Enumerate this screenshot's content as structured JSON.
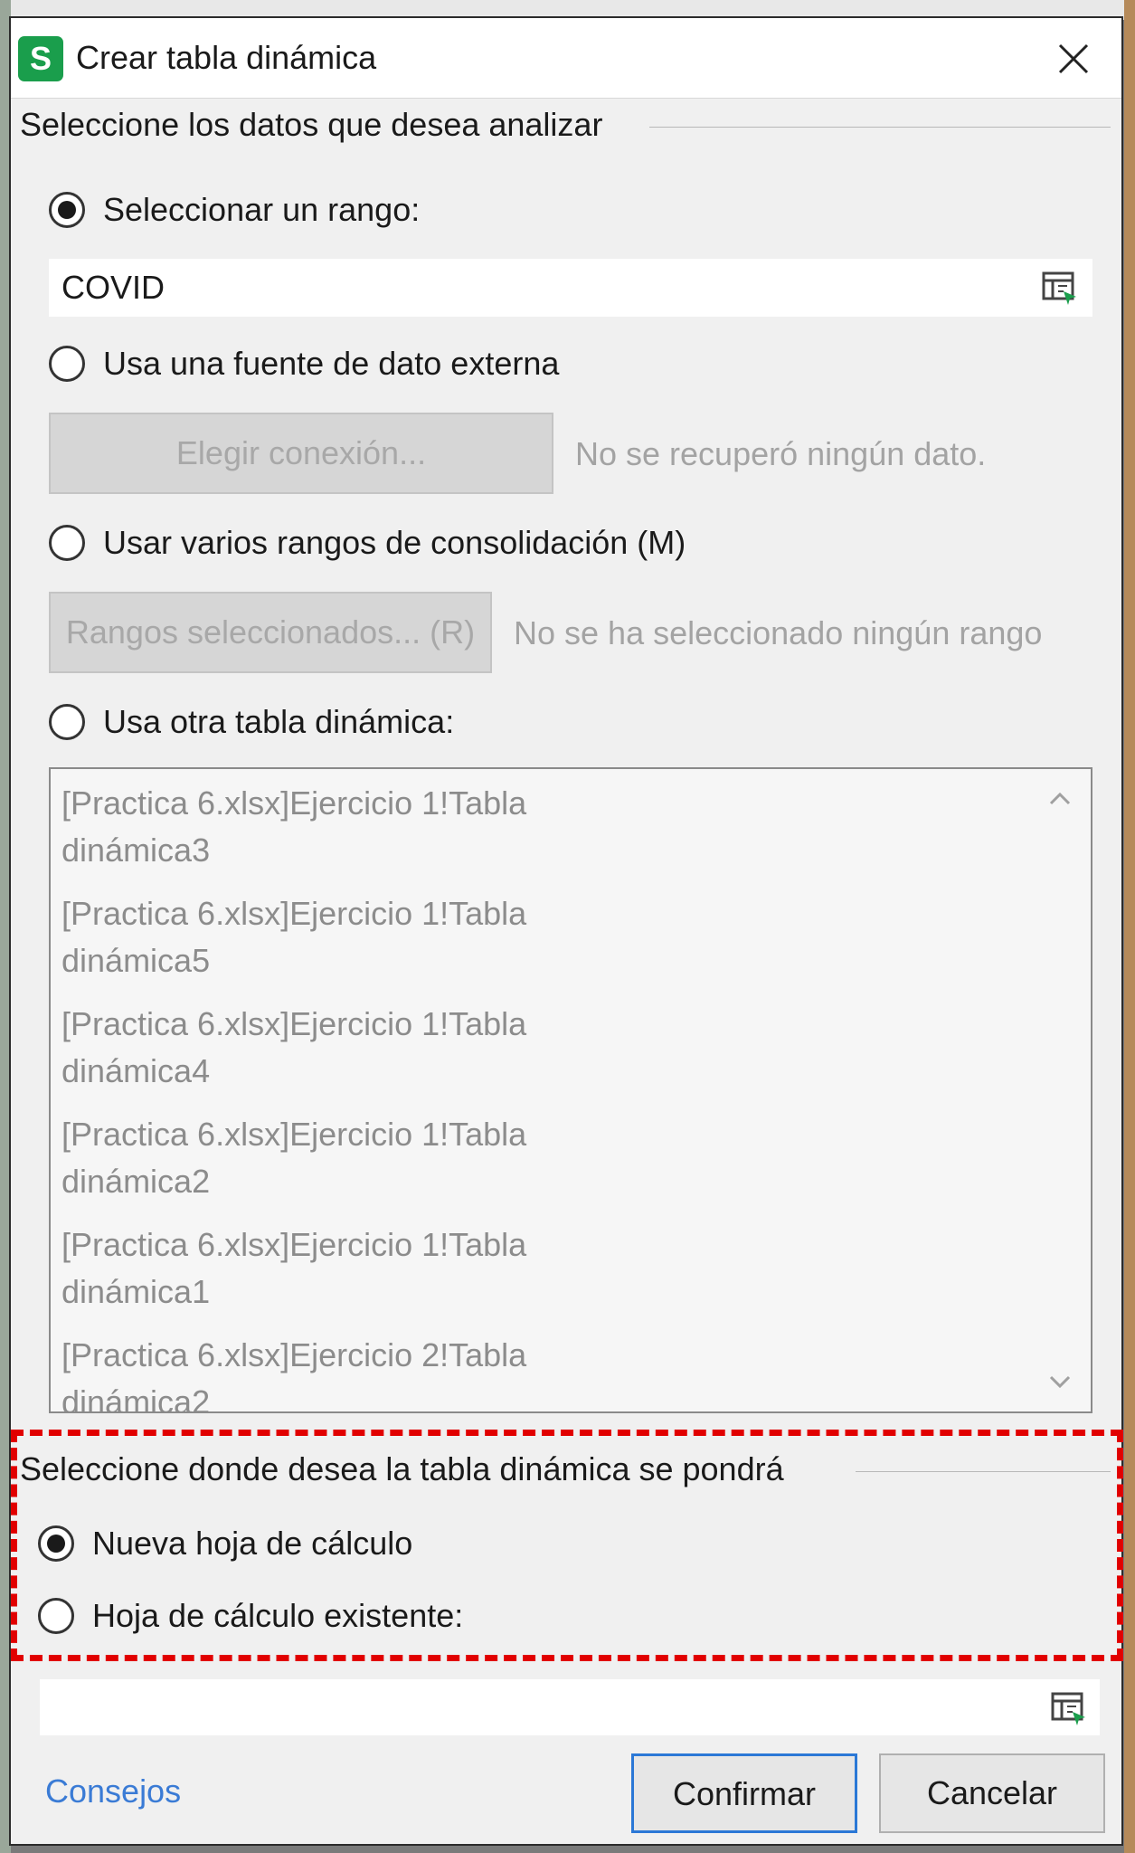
{
  "window": {
    "title": "Crear tabla dinámica",
    "app_icon_letter": "S",
    "accent_color": "#1a9e4c"
  },
  "source_section": {
    "header": "Seleccione los datos que desea analizar",
    "options": {
      "range": {
        "label": "Seleccionar un rango:",
        "selected": true,
        "value": "COVID"
      },
      "external": {
        "label": "Usa una fuente de dato externa",
        "selected": false,
        "button_label": "Elegir conexión...",
        "status": "No se recuperó ningún dato."
      },
      "consolidation": {
        "label": "Usar varios rangos de consolidación (M)",
        "selected": false,
        "button_label": "Rangos seleccionados... (R)",
        "status": "No se ha seleccionado ningún rango"
      },
      "other_pivot": {
        "label": "Usa otra tabla dinámica:",
        "selected": false
      }
    },
    "pivot_tables": [
      {
        "line1": "[Practica 6.xlsx]Ejercicio 1!Tabla",
        "line2": "dinámica3"
      },
      {
        "line1": "[Practica 6.xlsx]Ejercicio 1!Tabla",
        "line2": "dinámica5"
      },
      {
        "line1": "[Practica 6.xlsx]Ejercicio 1!Tabla",
        "line2": "dinámica4"
      },
      {
        "line1": "[Practica 6.xlsx]Ejercicio 1!Tabla",
        "line2": "dinámica2"
      },
      {
        "line1": "[Practica 6.xlsx]Ejercicio 1!Tabla",
        "line2": "dinámica1"
      },
      {
        "line1": "[Practica 6.xlsx]Ejercicio 2!Tabla",
        "line2": "dinámica2"
      }
    ]
  },
  "destination_section": {
    "header": "Seleccione donde desea la tabla dinámica se pondrá",
    "new_sheet": {
      "label": "Nueva hoja de cálculo",
      "selected": true
    },
    "existing_sheet": {
      "label": "Hoja de cálculo existente:",
      "selected": false,
      "value": ""
    }
  },
  "footer": {
    "tips_link": "Consejos",
    "confirm_label": "Confirmar",
    "cancel_label": "Cancelar"
  },
  "colors": {
    "highlight": "#e10000",
    "link": "#3a7bd5",
    "primary_border": "#2b78d6"
  }
}
